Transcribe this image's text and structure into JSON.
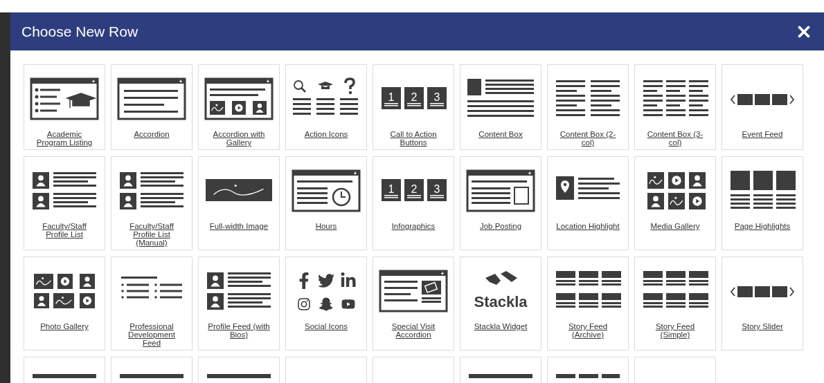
{
  "dialog": {
    "title": "Choose New Row"
  },
  "tiles": [
    {
      "label": "Academic Program Listing",
      "kind": "academic"
    },
    {
      "label": "Accordion",
      "kind": "accordion"
    },
    {
      "label": "Accordion with Gallery",
      "kind": "accordion-gallery"
    },
    {
      "label": "Action Icons",
      "kind": "action-icons"
    },
    {
      "label": "Call to Action Buttons",
      "kind": "numbers",
      "digits": [
        "1",
        "2",
        "3"
      ]
    },
    {
      "label": "Content Box",
      "kind": "content-box"
    },
    {
      "label": "Content Box (2-col)",
      "kind": "content-2col"
    },
    {
      "label": "Content Box (3-col)",
      "kind": "content-3col"
    },
    {
      "label": "Event Feed",
      "kind": "slider"
    },
    {
      "label": "Faculty/Staff Profile List",
      "kind": "profile-list"
    },
    {
      "label": "Faculty/Staff Profile List (Manual)",
      "kind": "profile-list"
    },
    {
      "label": "Full-width Image",
      "kind": "image"
    },
    {
      "label": "Hours",
      "kind": "hours"
    },
    {
      "label": "Infographics",
      "kind": "numbers",
      "digits": [
        "1",
        "2",
        "3"
      ]
    },
    {
      "label": "Job Posting",
      "kind": "job"
    },
    {
      "label": "Location Highlight",
      "kind": "location"
    },
    {
      "label": "Media Gallery",
      "kind": "media-gallery"
    },
    {
      "label": "Page Highlights",
      "kind": "highlights"
    },
    {
      "label": "Photo Gallery",
      "kind": "photo-gallery"
    },
    {
      "label": "Professional Development Feed",
      "kind": "professional"
    },
    {
      "label": "Profile Feed (with Bios)",
      "kind": "profile-list"
    },
    {
      "label": "Social Icons",
      "kind": "social"
    },
    {
      "label": "Special Visit Accordion",
      "kind": "special-visit"
    },
    {
      "label": "Stackla Widget",
      "kind": "stackla",
      "logo_text": "Stackla"
    },
    {
      "label": "Story Feed (Archive)",
      "kind": "story"
    },
    {
      "label": "Story Feed (Simple)",
      "kind": "story"
    },
    {
      "label": "Story Slider",
      "kind": "slider"
    },
    {
      "kind": "bar"
    },
    {
      "kind": "bar"
    },
    {
      "kind": "bar"
    },
    {
      "kind": "blank"
    },
    {
      "kind": "blank"
    },
    {
      "kind": "bar"
    },
    {
      "kind": "grid"
    },
    {
      "kind": "blank"
    }
  ]
}
